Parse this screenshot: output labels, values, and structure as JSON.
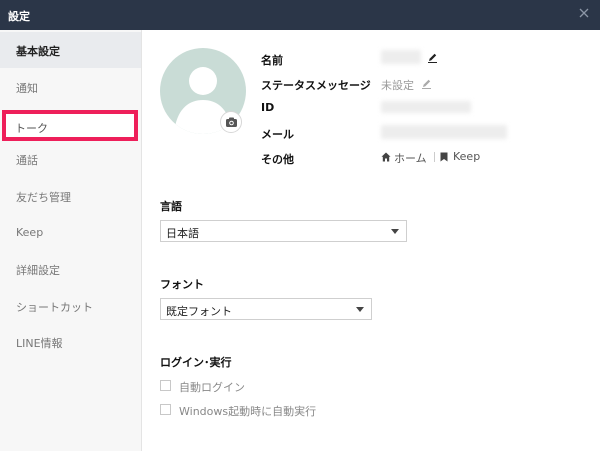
{
  "window": {
    "title": "設定"
  },
  "sidebar": {
    "items": [
      {
        "label": "基本設定"
      },
      {
        "label": "通知"
      },
      {
        "label": "トーク"
      },
      {
        "label": "通話"
      },
      {
        "label": "友だち管理"
      },
      {
        "label": "Keep"
      },
      {
        "label": "詳細設定"
      },
      {
        "label": "ショートカット"
      },
      {
        "label": "LINE情報"
      }
    ],
    "active_index": 0,
    "highlighted_index": 2,
    "highlight_color": "#ee1f5a"
  },
  "profile": {
    "name_label": "名前",
    "status_label": "ステータスメッセージ",
    "status_value": "未設定",
    "id_label": "ID",
    "mail_label": "メール",
    "other_label": "その他",
    "home_link": "ホーム",
    "keep_link": "Keep",
    "avatar_color": "#c9dcd6"
  },
  "language": {
    "label": "言語",
    "selected": "日本語"
  },
  "font": {
    "label": "フォント",
    "selected": "既定フォント"
  },
  "login": {
    "label": "ログイン･実行",
    "options": [
      {
        "label": "自動ログイン",
        "checked": false
      },
      {
        "label": "Windows起動時に自動実行",
        "checked": false
      }
    ]
  },
  "colors": {
    "titlebar": "#2b3648",
    "sidebar_bg": "#f7f7f7",
    "active_item_bg": "#e9ebee"
  }
}
